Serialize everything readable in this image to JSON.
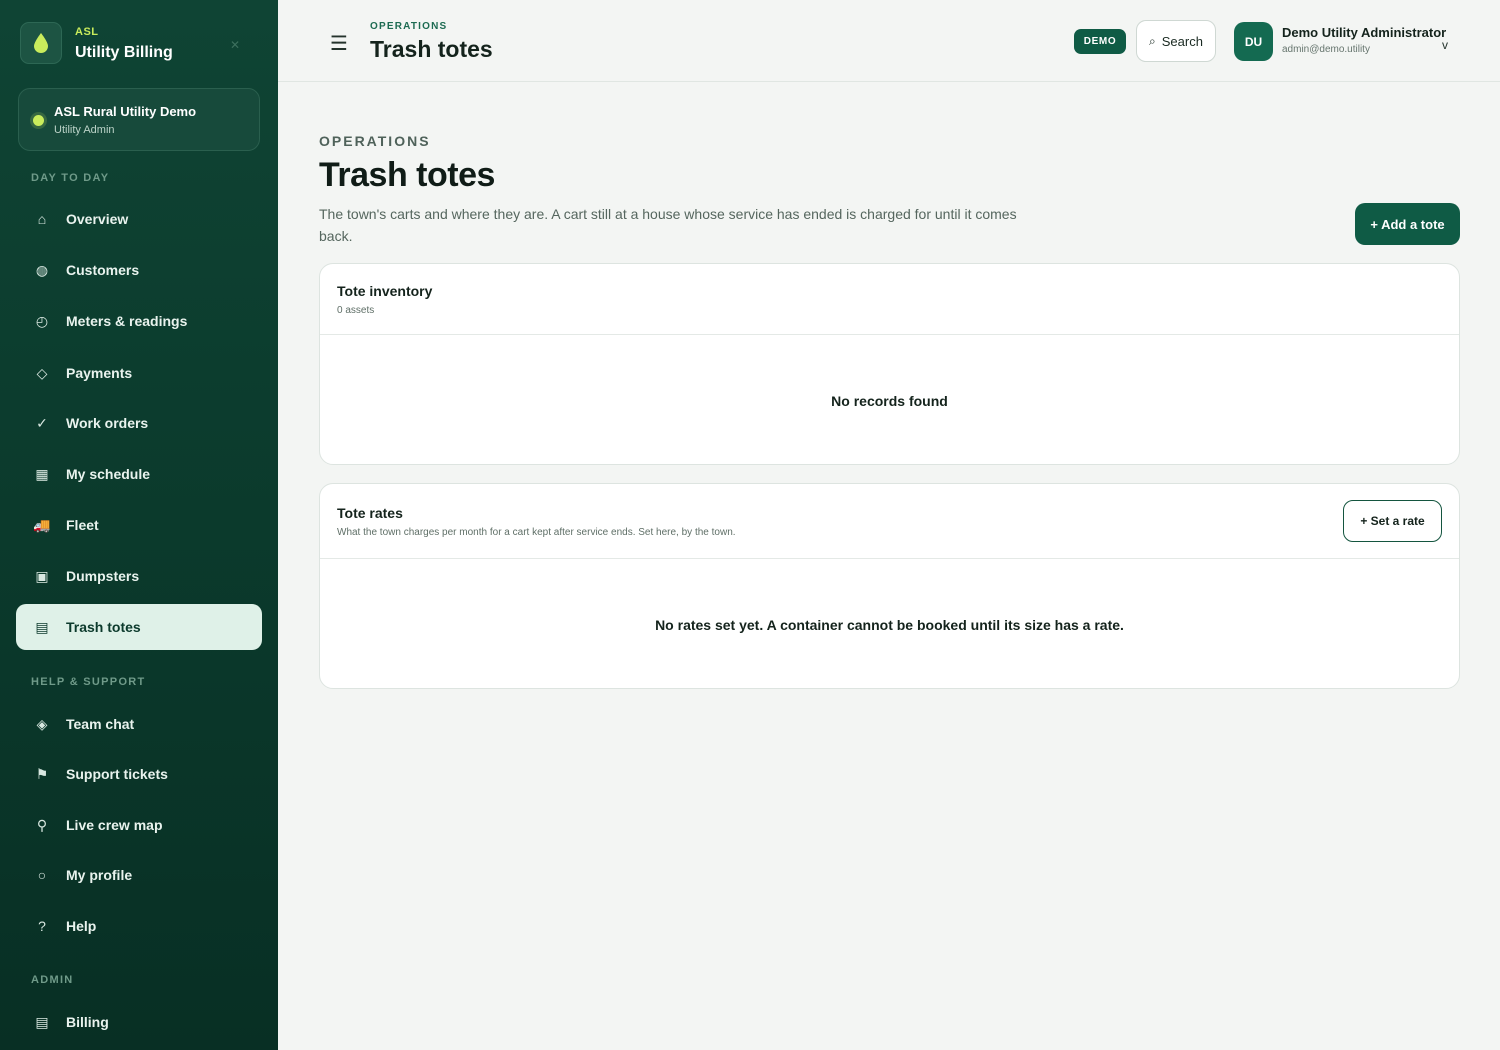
{
  "brand": {
    "kicker": "ASL",
    "title": "Utility Billing",
    "close_icon": "close-icon",
    "logo_icon": "droplet-icon",
    "accent_color": "#c9ec5c"
  },
  "org": {
    "name": "ASL Rural Utility Demo",
    "role": "Utility Admin"
  },
  "sidebar": {
    "sections": [
      {
        "label": "DAY TO DAY"
      },
      {
        "label": "HELP & SUPPORT"
      },
      {
        "label": "ADMIN"
      }
    ],
    "items": [
      {
        "label": "Overview",
        "icon": "⌂",
        "icon_name": "home-icon"
      },
      {
        "label": "Customers",
        "icon": "◍",
        "icon_name": "customers-icon"
      },
      {
        "label": "Meters & readings",
        "icon": "◴",
        "icon_name": "gauge-icon"
      },
      {
        "label": "Payments",
        "icon": "◇",
        "icon_name": "payments-icon"
      },
      {
        "label": "Work orders",
        "icon": "✓",
        "icon_name": "check-icon"
      },
      {
        "label": "My schedule",
        "icon": "▦",
        "icon_name": "calendar-icon"
      },
      {
        "label": "Fleet",
        "icon": "🚚",
        "icon_name": "truck-icon"
      },
      {
        "label": "Dumpsters",
        "icon": "▣",
        "icon_name": "dumpster-icon"
      },
      {
        "label": "Trash totes",
        "icon": "▤",
        "icon_name": "tote-icon"
      },
      {
        "label": "Team chat",
        "icon": "◈",
        "icon_name": "chat-icon"
      },
      {
        "label": "Support tickets",
        "icon": "⚑",
        "icon_name": "flag-icon"
      },
      {
        "label": "Live crew map",
        "icon": "⚲",
        "icon_name": "map-pin-icon"
      },
      {
        "label": "My profile",
        "icon": "○",
        "icon_name": "profile-icon"
      },
      {
        "label": "Help",
        "icon": "?",
        "icon_name": "help-icon"
      },
      {
        "label": "Billing",
        "icon": "▤",
        "icon_name": "billing-icon"
      }
    ],
    "active_item": "Trash totes"
  },
  "topbar": {
    "kicker": "OPERATIONS",
    "title": "Trash totes",
    "demo_badge": "DEMO",
    "search_label": "Search",
    "search_icon": "⌕",
    "avatar_initials": "DU",
    "user_name": "Demo Utility Administrator",
    "user_email": "admin@demo.utility",
    "caret": "v"
  },
  "page": {
    "kicker": "OPERATIONS",
    "title": "Trash totes",
    "description": "The town's carts and where they are. A cart still at a house whose service has ended is charged for until it comes back.",
    "add_button": "+ Add a tote"
  },
  "inventory": {
    "title": "Tote inventory",
    "subtitle": "0 assets",
    "empty": "No records found"
  },
  "rates": {
    "title": "Tote rates",
    "subtitle": "What the town charges per month for a cart kept after service ends. Set here, by the town.",
    "button": "+ Set a rate",
    "empty": "No rates set yet. A container cannot be booked until its size has a rate."
  },
  "colors": {
    "sidebar_bg": "#0b3a2c",
    "primary": "#0f5b45",
    "active_nav_bg": "#dff1e8",
    "page_bg": "#f3f5f3"
  }
}
